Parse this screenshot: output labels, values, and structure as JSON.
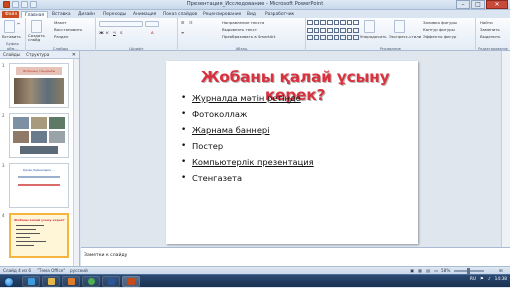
{
  "window": {
    "title": "Презентация_Исследование  -  Microsoft PowerPoint"
  },
  "ribbon_tabs": {
    "file": "Файл",
    "items": [
      "Главная",
      "Вставка",
      "Дизайн",
      "Переходы",
      "Анимация",
      "Показ слайдов",
      "Рецензирование",
      "Вид",
      "Разработчик"
    ],
    "active": "Главная"
  },
  "ribbon": {
    "clipboard": {
      "paste": "Вставить",
      "cut": "",
      "group": "Буфер обм..."
    },
    "slides": {
      "new_slide": "Создать слайд",
      "layout": "Макет",
      "reset": "Восстановить",
      "section": "Раздел",
      "group": "Слайды"
    },
    "font": {
      "group": "Шрифт"
    },
    "paragraph": {
      "text_direction": "Направление текста",
      "align_text": "Выровнять текст",
      "smartart": "Преобразовать в SmartArt",
      "group": "Абзац"
    },
    "drawing": {
      "arrange": "Упорядочить",
      "quick_styles": "Экспресс-стили",
      "fill": "Заливка фигуры",
      "outline": "Контур фигуры",
      "effects": "Эффекты фигур",
      "group": "Рисование"
    },
    "editing": {
      "find": "Найти",
      "replace": "Заменить",
      "select": "Выделить",
      "group": "Редактирование"
    }
  },
  "left_panel": {
    "tab_slides": "Слайды",
    "tab_outline": "Структура",
    "slides": [
      {
        "num": "1",
        "caption": "Жобаның тақырыбы"
      },
      {
        "num": "2",
        "caption": ""
      },
      {
        "num": "3",
        "caption": "Қазақ бейнелерін ..."
      },
      {
        "num": "4",
        "caption": "Жобаны қалай ұсыну керек?"
      }
    ]
  },
  "slide": {
    "title": "Жобаны қалай ұсыну керек?",
    "bullets": [
      {
        "text": "Журналда мәтін ретінде",
        "link": true
      },
      {
        "text": "Фотоколлаж",
        "link": false
      },
      {
        "text": "Жарнама баннері",
        "link": true
      },
      {
        "text": "Постер",
        "link": false
      },
      {
        "text": "Компьютерлік презентация",
        "link": true
      },
      {
        "text": "Стенгазета",
        "link": false
      }
    ]
  },
  "notes": {
    "placeholder": "Заметки к слайду"
  },
  "status": {
    "slide_info": "Слайд 4 из 6",
    "theme": "\"Тема Office\"",
    "language": "русский",
    "zoom": "58%"
  },
  "tray": {
    "lang": "RU",
    "time": "14:38"
  },
  "colors": {
    "title_red": "#d9323f",
    "file_tab": "#c94b1f",
    "selected_thumb": "#f4b63f"
  }
}
